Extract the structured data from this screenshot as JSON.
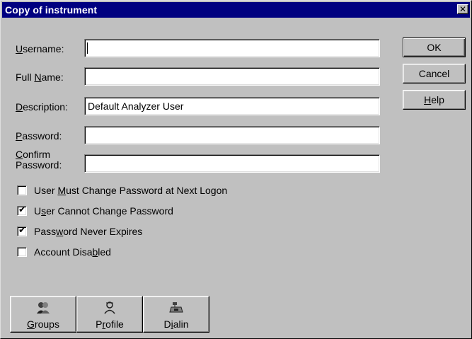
{
  "window": {
    "title": "Copy of instrument",
    "close_glyph": "✕"
  },
  "fields": {
    "username": {
      "label_pre": "",
      "label_accel": "U",
      "label_post": "sername:",
      "value": ""
    },
    "fullname": {
      "label_pre": "Full ",
      "label_accel": "N",
      "label_post": "ame:",
      "value": ""
    },
    "description": {
      "label_pre": "",
      "label_accel": "D",
      "label_post": "escription:",
      "value": "Default Analyzer User"
    },
    "password": {
      "label_pre": "",
      "label_accel": "P",
      "label_post": "assword:",
      "value": ""
    },
    "confirm": {
      "label_line1_accel": "C",
      "label_line1_post": "onfirm",
      "label_line2": "Password:",
      "value": ""
    }
  },
  "buttons": {
    "ok": "OK",
    "cancel": "Cancel",
    "help_accel": "H",
    "help_post": "elp"
  },
  "checkboxes": [
    {
      "pre": "User ",
      "accel": "M",
      "post": "ust Change Password at Next Logon",
      "checked": false
    },
    {
      "pre": "U",
      "accel": "s",
      "post": "er Cannot Change Password",
      "checked": true
    },
    {
      "pre": "Pass",
      "accel": "w",
      "post": "ord Never Expires",
      "checked": true
    },
    {
      "pre": "Account Disa",
      "accel": "b",
      "post": "led",
      "checked": false
    }
  ],
  "bottom_buttons": {
    "groups": {
      "pre": "",
      "accel": "G",
      "post": "roups",
      "icon": "groups-icon"
    },
    "profile": {
      "pre": "P",
      "accel": "r",
      "post": "ofile",
      "icon": "profile-icon"
    },
    "dialin": {
      "pre": "D",
      "accel": "i",
      "post": "alin",
      "icon": "dialin-icon"
    }
  },
  "check_glyph": "✔"
}
